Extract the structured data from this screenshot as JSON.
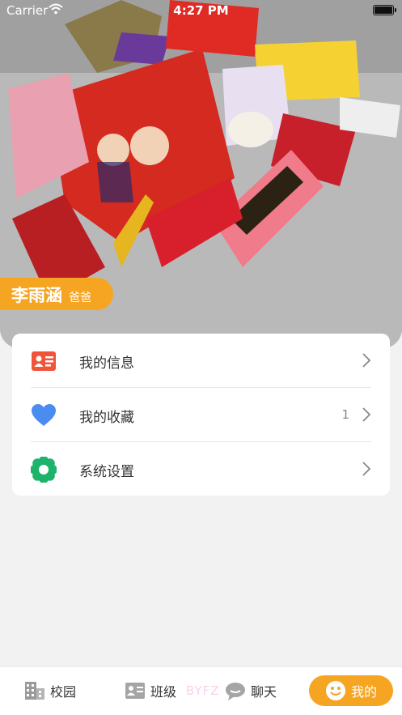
{
  "status_bar": {
    "carrier": "Carrier",
    "time": "4:27 PM"
  },
  "profile": {
    "name": "李雨涵",
    "role": "爸爸"
  },
  "menu": [
    {
      "label": "我的信息",
      "count": "",
      "icon": "id-card-icon"
    },
    {
      "label": "我的收藏",
      "count": "1",
      "icon": "heart-icon"
    },
    {
      "label": "系统设置",
      "count": "",
      "icon": "settings-flower-icon"
    }
  ],
  "tabs": [
    {
      "label": "校园",
      "icon": "campus-building-icon",
      "active": false
    },
    {
      "label": "班级",
      "icon": "class-icon",
      "active": false
    },
    {
      "label": "聊天",
      "icon": "chat-bubble-icon",
      "active": false
    },
    {
      "label": "我的",
      "icon": "smiley-face-icon",
      "active": true
    }
  ],
  "watermark": "BYFZ",
  "colors": {
    "accent": "#f6a523",
    "heart": "#4a8cf0",
    "settings": "#1db36a",
    "id_card": "#f0553a"
  }
}
